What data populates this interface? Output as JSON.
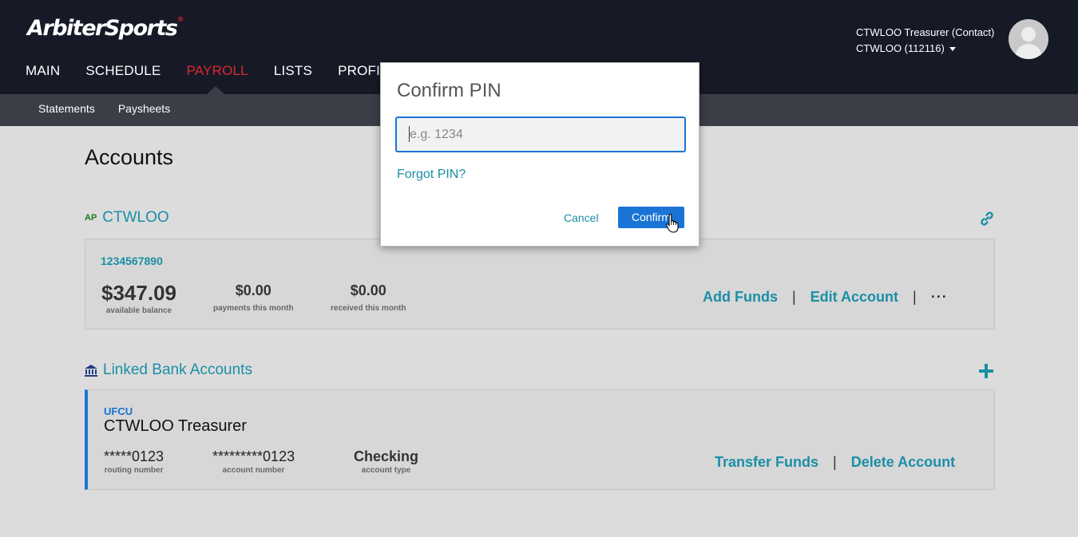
{
  "header": {
    "logo_arbiter": "Arbiter",
    "logo_sports": "Sports",
    "logo_mark": "®",
    "nav": [
      "MAIN",
      "SCHEDULE",
      "PAYROLL",
      "LISTS",
      "PROFIL"
    ],
    "active_nav": "PAYROLL",
    "user_name": "CTWLOO Treasurer (Contact)",
    "user_org": "CTWLOO (112116)"
  },
  "subnav": [
    "Statements",
    "Paysheets"
  ],
  "page": {
    "title": "Accounts"
  },
  "account_section": {
    "badge": "AP",
    "title": "CTWLOO",
    "link_icon": "link-icon",
    "account_number": "1234567890",
    "available_balance": "$347.09",
    "available_balance_label": "available balance",
    "payments": "$0.00",
    "payments_label": "payments this month",
    "received": "$0.00",
    "received_label": "received this month",
    "add_funds": "Add Funds",
    "edit_account": "Edit Account",
    "more": "···"
  },
  "linked_section": {
    "icon": "bank-icon",
    "title": "Linked Bank Accounts",
    "add_icon": "plus-icon",
    "bank_name": "UFCU",
    "holder": "CTWLOO Treasurer",
    "routing": "*****0123",
    "routing_label": "routing number",
    "account": "*********0123",
    "account_label": "account number",
    "type": "Checking",
    "type_label": "account type",
    "transfer_funds": "Transfer Funds",
    "delete_account": "Delete Account"
  },
  "modal": {
    "title": "Confirm PIN",
    "pin_placeholder": "e.g. 1234",
    "pin_value": "",
    "forgot": "Forgot PIN?",
    "cancel": "Cancel",
    "confirm": "Confirm"
  },
  "colors": {
    "header_bg": "#161a27",
    "subbar_bg": "#3b3e47",
    "active_nav": "#e0262d",
    "link": "#1a8fa5",
    "primary": "#1a74d6"
  }
}
